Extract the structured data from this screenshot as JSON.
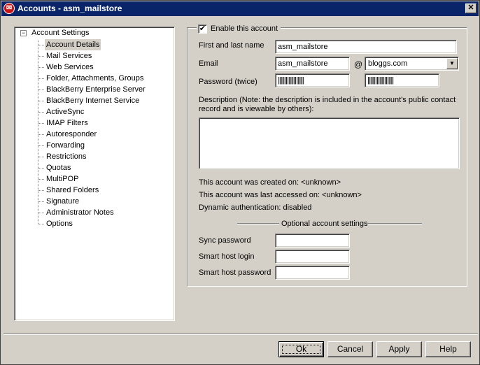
{
  "window": {
    "title": "Accounts - asm_mailstore",
    "close_glyph": "✕"
  },
  "tree": {
    "root_label": "Account Settings",
    "expander_glyph": "−",
    "items": [
      "Account Details",
      "Mail Services",
      "Web Services",
      "Folder, Attachments, Groups",
      "BlackBerry Enterprise Server",
      "BlackBerry Internet Service",
      "ActiveSync",
      "IMAP Filters",
      "Autoresponder",
      "Forwarding",
      "Restrictions",
      "Quotas",
      "MultiPOP",
      "Shared Folders",
      "Signature",
      "Administrator Notes",
      "Options"
    ],
    "selected": "Account Details"
  },
  "form": {
    "enable_label": "Enable this account",
    "enable_checked": true,
    "check_glyph": "✔",
    "name_label": "First and last name",
    "name_value": "asm_mailstore",
    "email_label": "Email",
    "email_user_value": "asm_mailstore",
    "at_sign": "@",
    "email_domain_value": "bloggs.com",
    "password_label": "Password (twice)",
    "password_mask_1": "||||||||||||||||||||",
    "password_mask_2": "||||||||||||||||||||",
    "description_label": "Description (Note: the description is included in the account's public contact record and is viewable by others):",
    "description_value": "",
    "created_text": "This account was created on: <unknown>",
    "accessed_text": "This account was last accessed on: <unknown>",
    "dynamic_auth_text": "Dynamic authentication: disabled",
    "optional_header": "Optional account settings",
    "sync_password_label": "Sync password",
    "sync_password_value": "",
    "smart_login_label": "Smart host login",
    "smart_login_value": "",
    "smart_password_label": "Smart host password",
    "smart_password_value": ""
  },
  "buttons": {
    "ok": "Ok",
    "cancel": "Cancel",
    "apply": "Apply",
    "help": "Help"
  },
  "colors": {
    "titlebar": "#0a246a",
    "face": "#d4d0c8"
  },
  "icons": {
    "app": "mdaemon-app-icon",
    "combo_arrow": "▼"
  }
}
